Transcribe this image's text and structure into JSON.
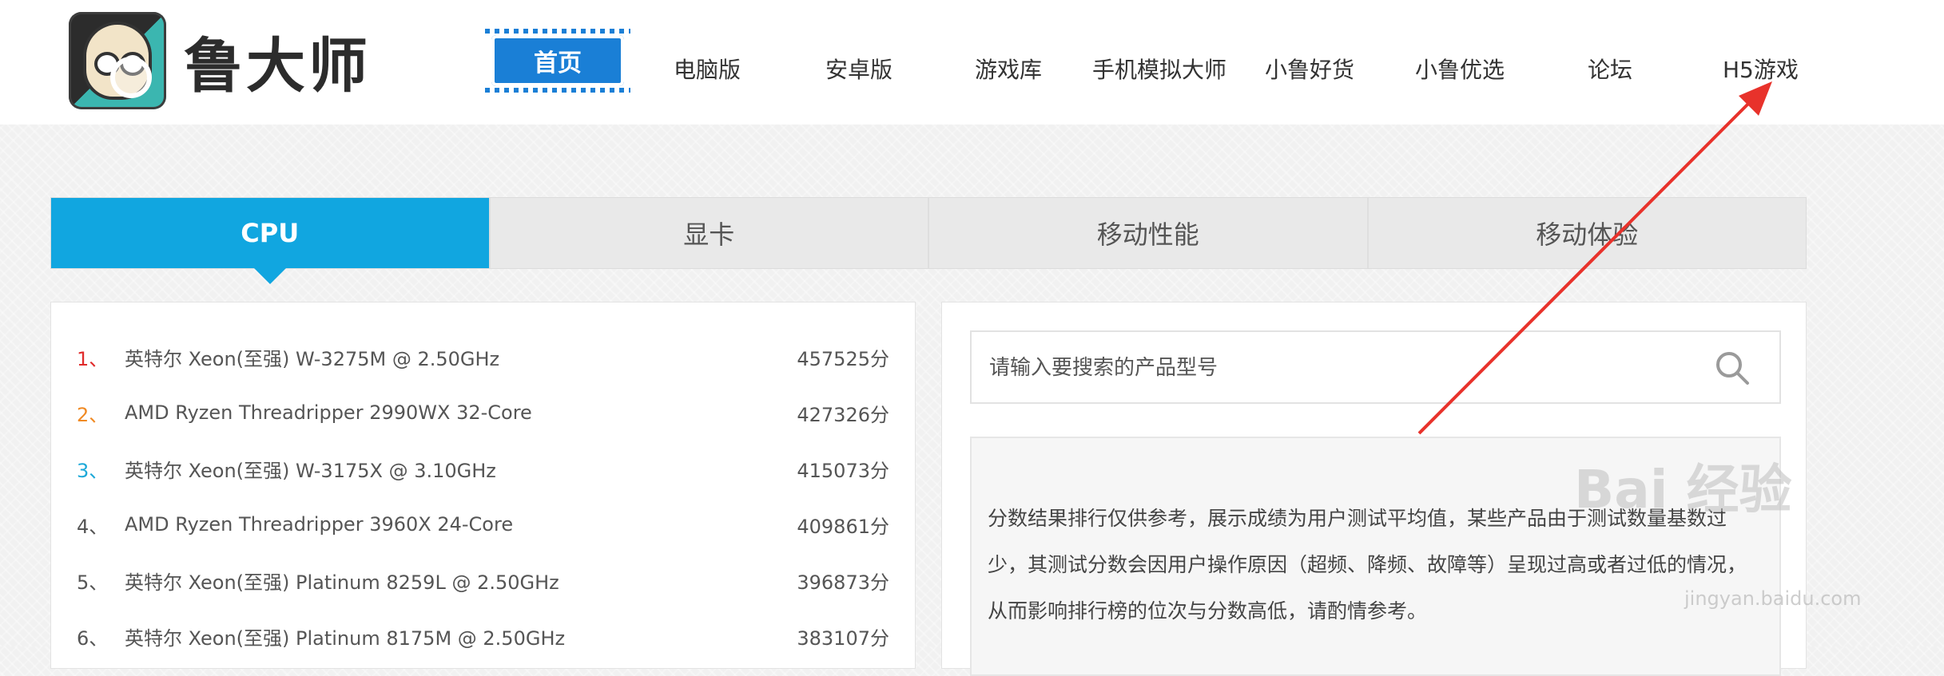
{
  "header": {
    "logo_text": "鲁大师",
    "nav": {
      "home": "首页",
      "items": [
        "电脑版",
        "安卓版",
        "游戏库",
        "手机模拟大师",
        "小鲁好货",
        "小鲁优选",
        "论坛",
        "H5游戏"
      ]
    }
  },
  "tabs": [
    "CPU",
    "显卡",
    "移动性能",
    "移动体验"
  ],
  "ranking": [
    {
      "rank": "1、",
      "name": "英特尔 Xeon(至强) W-3275M @ 2.50GHz",
      "score": "457525分",
      "rank_color": "#e02b2b"
    },
    {
      "rank": "2、",
      "name": "AMD Ryzen Threadripper 2990WX 32-Core",
      "score": "427326分",
      "rank_color": "#f08a24"
    },
    {
      "rank": "3、",
      "name": "英特尔 Xeon(至强) W-3175X @ 3.10GHz",
      "score": "415073分",
      "rank_color": "#1ea9d8"
    },
    {
      "rank": "4、",
      "name": "AMD Ryzen Threadripper 3960X 24-Core",
      "score": "409861分",
      "rank_color": "#555555"
    },
    {
      "rank": "5、",
      "name": "英特尔 Xeon(至强) Platinum 8259L @ 2.50GHz",
      "score": "396873分",
      "rank_color": "#555555"
    },
    {
      "rank": "6、",
      "name": "英特尔 Xeon(至强) Platinum 8175M @ 2.50GHz",
      "score": "383107分",
      "rank_color": "#555555"
    }
  ],
  "search": {
    "placeholder": "请输入要搜索的产品型号"
  },
  "notice": {
    "text": "分数结果排行仅供参考，展示成绩为用户测试平均值，某些产品由于测试数量基数过少，其测试分数会因用户操作原因（超频、降频、故障等）呈现过高或者过低的情况，从而影响排行榜的位次与分数高低，请酌情参考。"
  },
  "watermark": {
    "text": "Bai 经验",
    "sub": "jingyan.baidu.com"
  },
  "colors": {
    "accent": "#11a6e0",
    "home_button": "#1a7fd6",
    "annotation_arrow": "#e8322b"
  }
}
